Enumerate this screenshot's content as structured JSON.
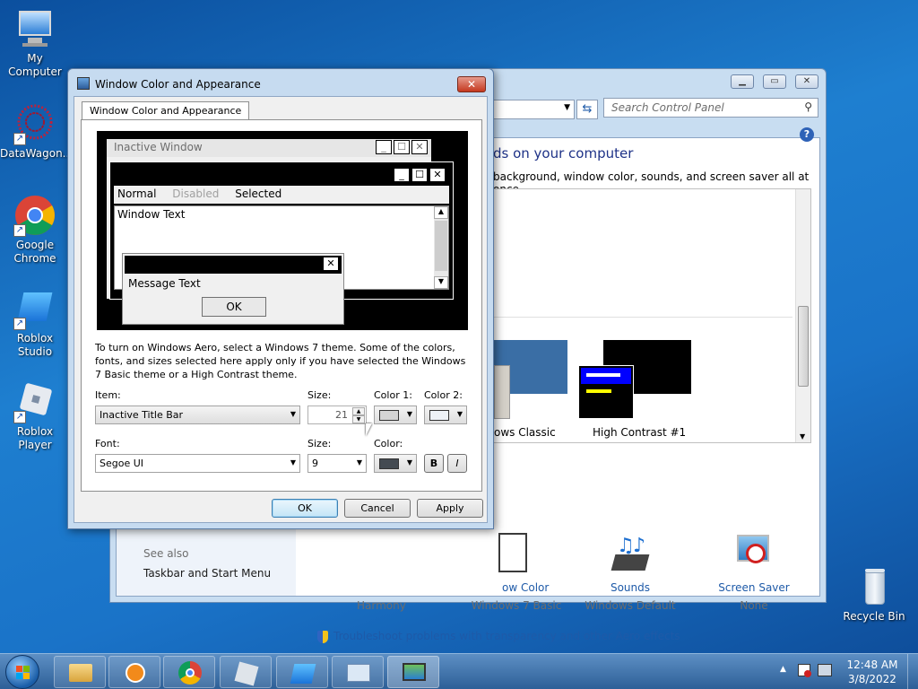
{
  "desktop": {
    "icons": [
      {
        "label": "My Computer"
      },
      {
        "label": "DataWagon..."
      },
      {
        "label": "Google Chrome"
      },
      {
        "label": "Roblox Studio"
      },
      {
        "label": "Roblox Player"
      },
      {
        "label": "Recycle Bin"
      }
    ]
  },
  "control_panel": {
    "search_placeholder": "Search Control Panel",
    "heading": "ds on your computer",
    "description": "background, window color, sounds, and screen saver all at once.",
    "themes": [
      {
        "label": "ows Classic"
      },
      {
        "label": "High Contrast #1"
      }
    ],
    "bottom_items": [
      {
        "title": "ow Color",
        "subtitle": "Windows 7 Basic"
      },
      {
        "title": "Sounds",
        "subtitle": "Windows Default"
      },
      {
        "title": "Screen Saver",
        "subtitle": "None"
      }
    ],
    "harmony": "Harmony",
    "see_also_heading": "See also",
    "see_also_link": "Taskbar and Start Menu",
    "troubleshoot_link": "Troubleshoot problems with transparency and other Aero effects"
  },
  "dialog": {
    "title": "Window Color and Appearance",
    "tab": "Window Color and Appearance",
    "preview": {
      "inactive_window": "Inactive Window",
      "menu_normal": "Normal",
      "menu_disabled": "Disabled",
      "menu_selected": "Selected",
      "window_text": "Window Text",
      "message_text": "Message Text",
      "ok": "OK"
    },
    "info_text": "To turn on Windows Aero, select a Windows 7 theme.  Some of the colors, fonts, and sizes selected here apply only if you have selected the Windows 7 Basic theme or a High Contrast theme.",
    "item_label": "Item:",
    "item_value": "Inactive Title Bar",
    "size_label": "Size:",
    "size_value": "21",
    "color1_label": "Color 1:",
    "color2_label": "Color 2:",
    "font_label": "Font:",
    "font_value": "Segoe UI",
    "font_size_label": "Size:",
    "font_size_value": "9",
    "font_color_label": "Color:",
    "bold_label": "B",
    "italic_label": "I",
    "ok": "OK",
    "cancel": "Cancel",
    "apply": "Apply"
  },
  "taskbar": {
    "time": "12:48 AM",
    "date": "3/8/2022"
  },
  "colors": {
    "link": "#1e5aa8",
    "high_contrast_blue": "#0000ff",
    "classic_blue": "#3a6ea5"
  }
}
